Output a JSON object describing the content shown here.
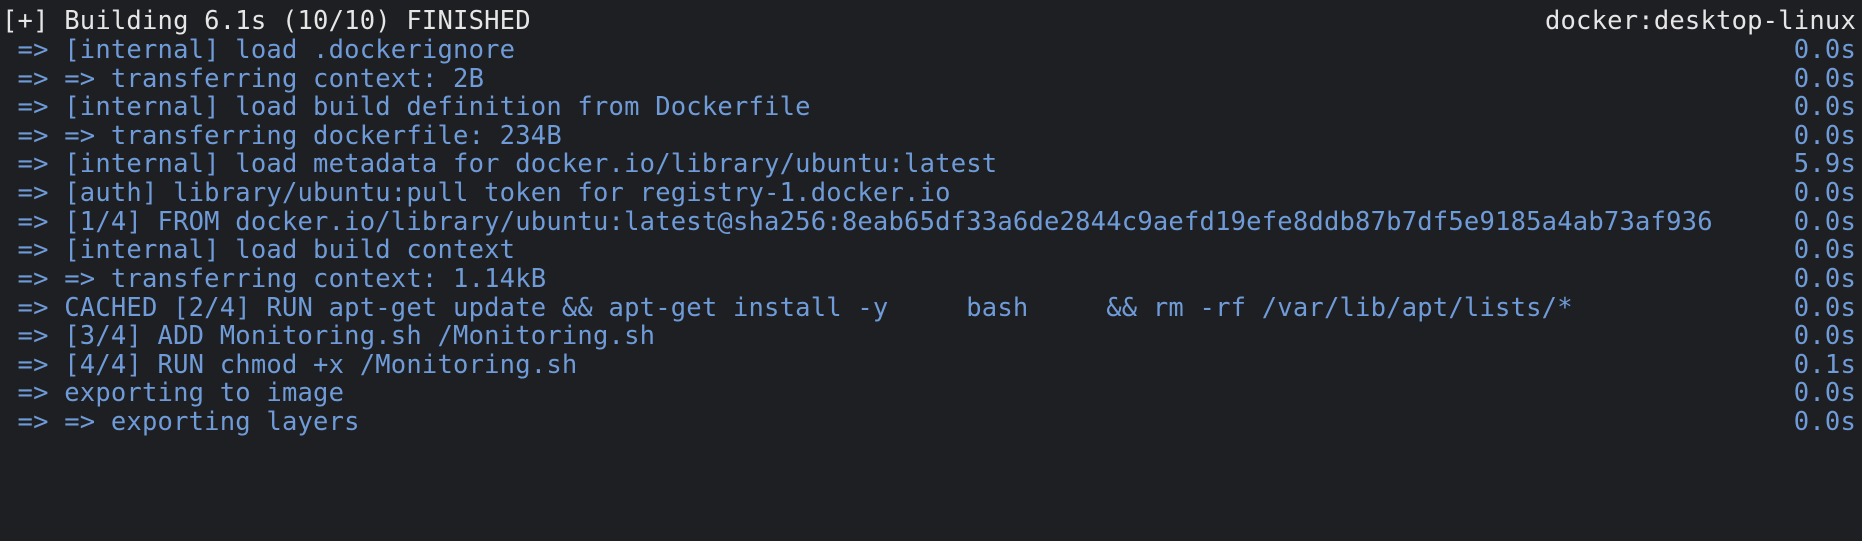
{
  "header": {
    "status": "[+] Building 6.1s (10/10) FINISHED",
    "context": "docker:desktop-linux"
  },
  "steps": [
    {
      "text": " => [internal] load .dockerignore",
      "time": "0.0s"
    },
    {
      "text": " => => transferring context: 2B",
      "time": "0.0s"
    },
    {
      "text": " => [internal] load build definition from Dockerfile",
      "time": "0.0s"
    },
    {
      "text": " => => transferring dockerfile: 234B",
      "time": "0.0s"
    },
    {
      "text": " => [internal] load metadata for docker.io/library/ubuntu:latest",
      "time": "5.9s"
    },
    {
      "text": " => [auth] library/ubuntu:pull token for registry-1.docker.io",
      "time": "0.0s"
    },
    {
      "text": " => [1/4] FROM docker.io/library/ubuntu:latest@sha256:8eab65df33a6de2844c9aefd19efe8ddb87b7df5e9185a4ab73af936",
      "time": "0.0s"
    },
    {
      "text": " => [internal] load build context",
      "time": "0.0s"
    },
    {
      "text": " => => transferring context: 1.14kB",
      "time": "0.0s"
    },
    {
      "text": " => CACHED [2/4] RUN apt-get update && apt-get install -y     bash     && rm -rf /var/lib/apt/lists/*",
      "time": "0.0s"
    },
    {
      "text": " => [3/4] ADD Monitoring.sh /Monitoring.sh",
      "time": "0.0s"
    },
    {
      "text": " => [4/4] RUN chmod +x /Monitoring.sh",
      "time": "0.1s"
    },
    {
      "text": " => exporting to image",
      "time": "0.0s"
    },
    {
      "text": " => => exporting layers",
      "time": "0.0s"
    }
  ],
  "colors": {
    "background": "#1e1f22",
    "header_text": "#e6e6e6",
    "step_text": "#6f9bd8"
  }
}
